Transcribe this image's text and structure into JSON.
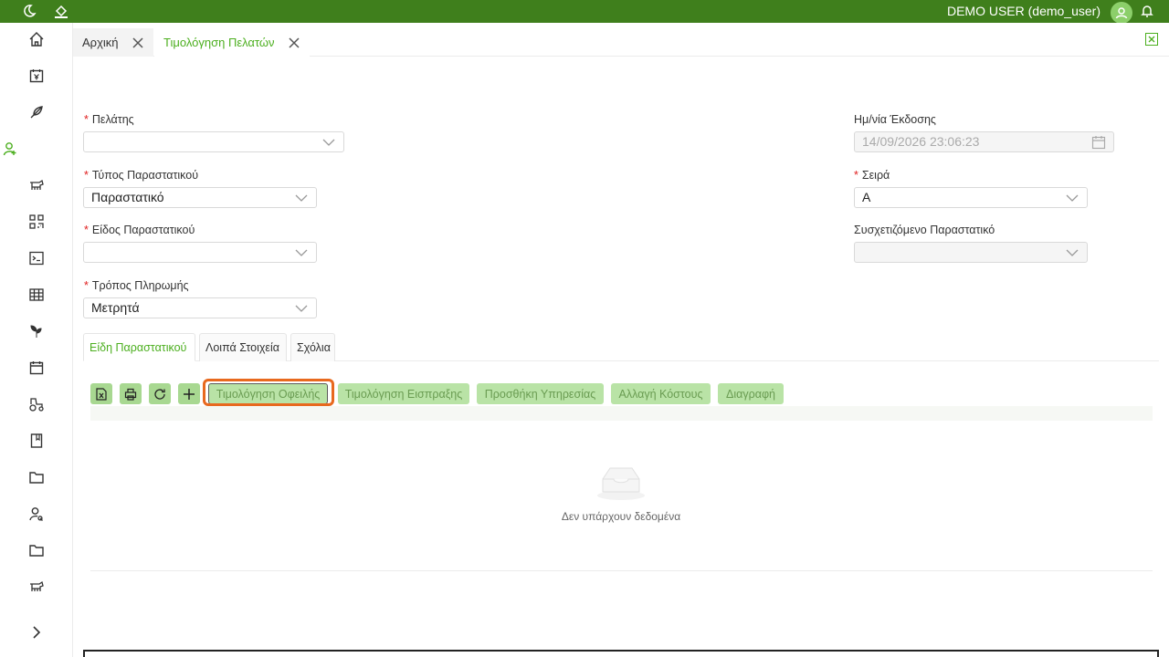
{
  "topbar": {
    "user": "DEMO USER (demo_user)"
  },
  "tabs": [
    {
      "label": "Αρχική"
    },
    {
      "label": "Τιμολόγηση Πελατών"
    }
  ],
  "form": {
    "customer": {
      "label": "Πελάτης",
      "value": ""
    },
    "doc_type": {
      "label": "Τύπος Παραστατικού",
      "value": "Παραστατικό"
    },
    "doc_kind": {
      "label": "Είδος Παραστατικού",
      "value": ""
    },
    "payment": {
      "label": "Τρόπος Πληρωμής",
      "value": "Μετρητά"
    },
    "issue_date": {
      "label": "Ημ/νία Έκδοσης",
      "value": "14/09/2026 23:06:23"
    },
    "series": {
      "label": "Σειρά",
      "value": "A"
    },
    "related_doc": {
      "label": "Συσχετιζόμενο Παραστατικό",
      "value": ""
    }
  },
  "detail_tabs": [
    {
      "label": "Είδη Παραστατικού"
    },
    {
      "label": "Λοιπά Στοιχεία"
    },
    {
      "label": "Σχόλια"
    }
  ],
  "actions": {
    "invoice_debt": "Τιμολόγηση Οφειλής",
    "invoice_receipt": "Τιμολόγηση Εισπραξης",
    "add_service": "Προσθήκη Υπηρεσίας",
    "change_cost": "Αλλαγή Κόστους",
    "delete": "Διαγραφή"
  },
  "grid": {
    "empty_text": "Δεν υπάρχουν δεδομένα"
  },
  "colors": {
    "topbar": "#3f7f1c",
    "accent": "#4caf1f",
    "button": "#b9e3a6",
    "highlight": "#e8691e"
  }
}
